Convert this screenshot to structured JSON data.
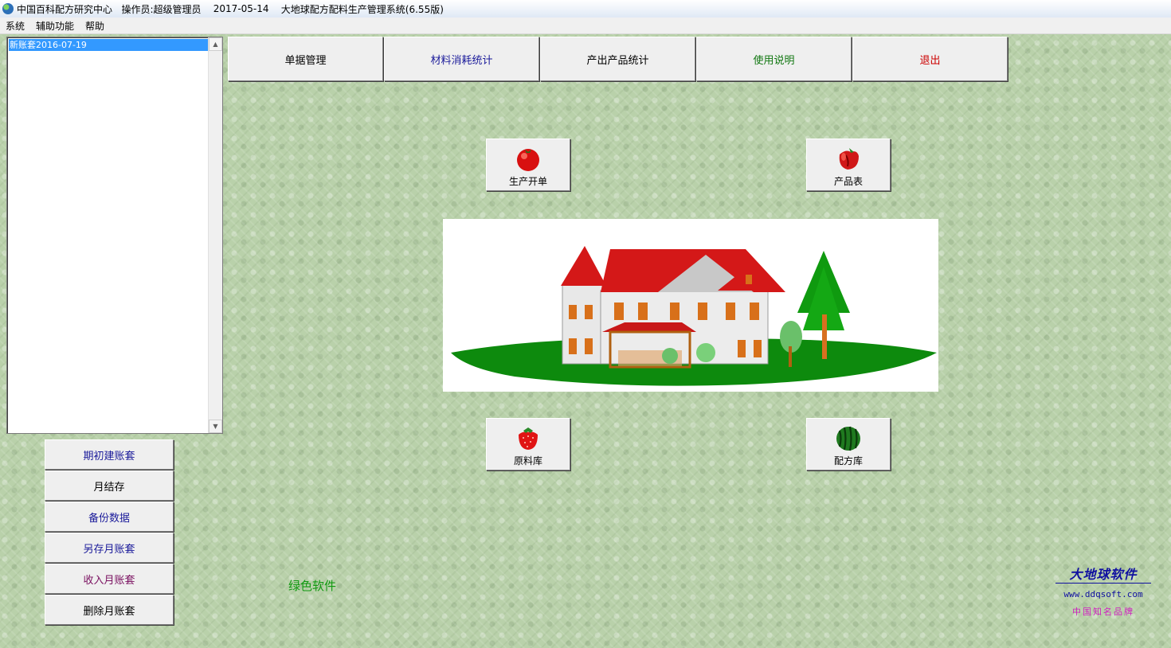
{
  "titlebar": {
    "org": "中国百科配方研究中心",
    "operator": "操作员:超级管理员",
    "date": "2017-05-14",
    "app_title": "大地球配方配料生产管理系统(6.55版)"
  },
  "menu": [
    "系统",
    "辅助功能",
    "帮助"
  ],
  "account_list": {
    "items": [
      "新账套2016-07-19"
    ]
  },
  "top_buttons": [
    {
      "label": "单据管理",
      "color": "#000000"
    },
    {
      "label": "材料消耗统计",
      "color": "#1a1a9a"
    },
    {
      "label": "产出产品统计",
      "color": "#000000"
    },
    {
      "label": "使用说明",
      "color": "#117711"
    },
    {
      "label": "退出",
      "color": "#cc0000"
    }
  ],
  "icon_buttons": [
    {
      "label": "生产开单",
      "icon": "tomato-icon"
    },
    {
      "label": "产品表",
      "icon": "pepper-icon"
    },
    {
      "label": "原料库",
      "icon": "strawberry-icon"
    },
    {
      "label": "配方库",
      "icon": "watermelon-icon"
    }
  ],
  "left_buttons": [
    {
      "label": "期初建账套",
      "color": "#1a1a9a"
    },
    {
      "label": "月结存",
      "color": "#000000"
    },
    {
      "label": "备份数据",
      "color": "#1a1a9a"
    },
    {
      "label": "另存月账套",
      "color": "#1a1a9a"
    },
    {
      "label": "收入月账套",
      "color": "#7a1060"
    },
    {
      "label": "删除月账套",
      "color": "#000000"
    }
  ],
  "footer": {
    "green_text": "绿色软件",
    "brand_name": "大地球软件",
    "brand_url": "www.ddqsoft.com",
    "brand_slogan": "中国知名品牌"
  }
}
